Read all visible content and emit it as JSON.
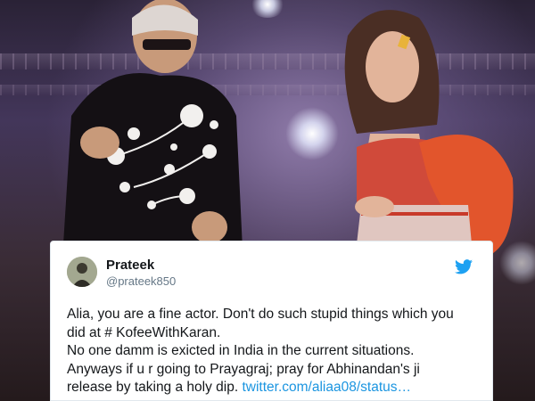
{
  "tweet": {
    "user_name": "Prateek",
    "user_handle": "@prateek850",
    "lines": [
      "Alia, you are a fine actor. Don't do such stupid things which you",
      "did at # KofeeWithKaran.",
      "No one damm is exicted in India in the current situations.",
      "Anyways if u r going to Prayagraj; pray for Abhinandan's ji",
      "release by taking a holy dip."
    ],
    "link_text": "twitter.com/aliaa08/status…"
  },
  "colors": {
    "link": "#1b95e0",
    "twitter_blue": "#1da1f2",
    "handle_gray": "#657786"
  },
  "icons": [
    "twitter-bird-icon"
  ]
}
